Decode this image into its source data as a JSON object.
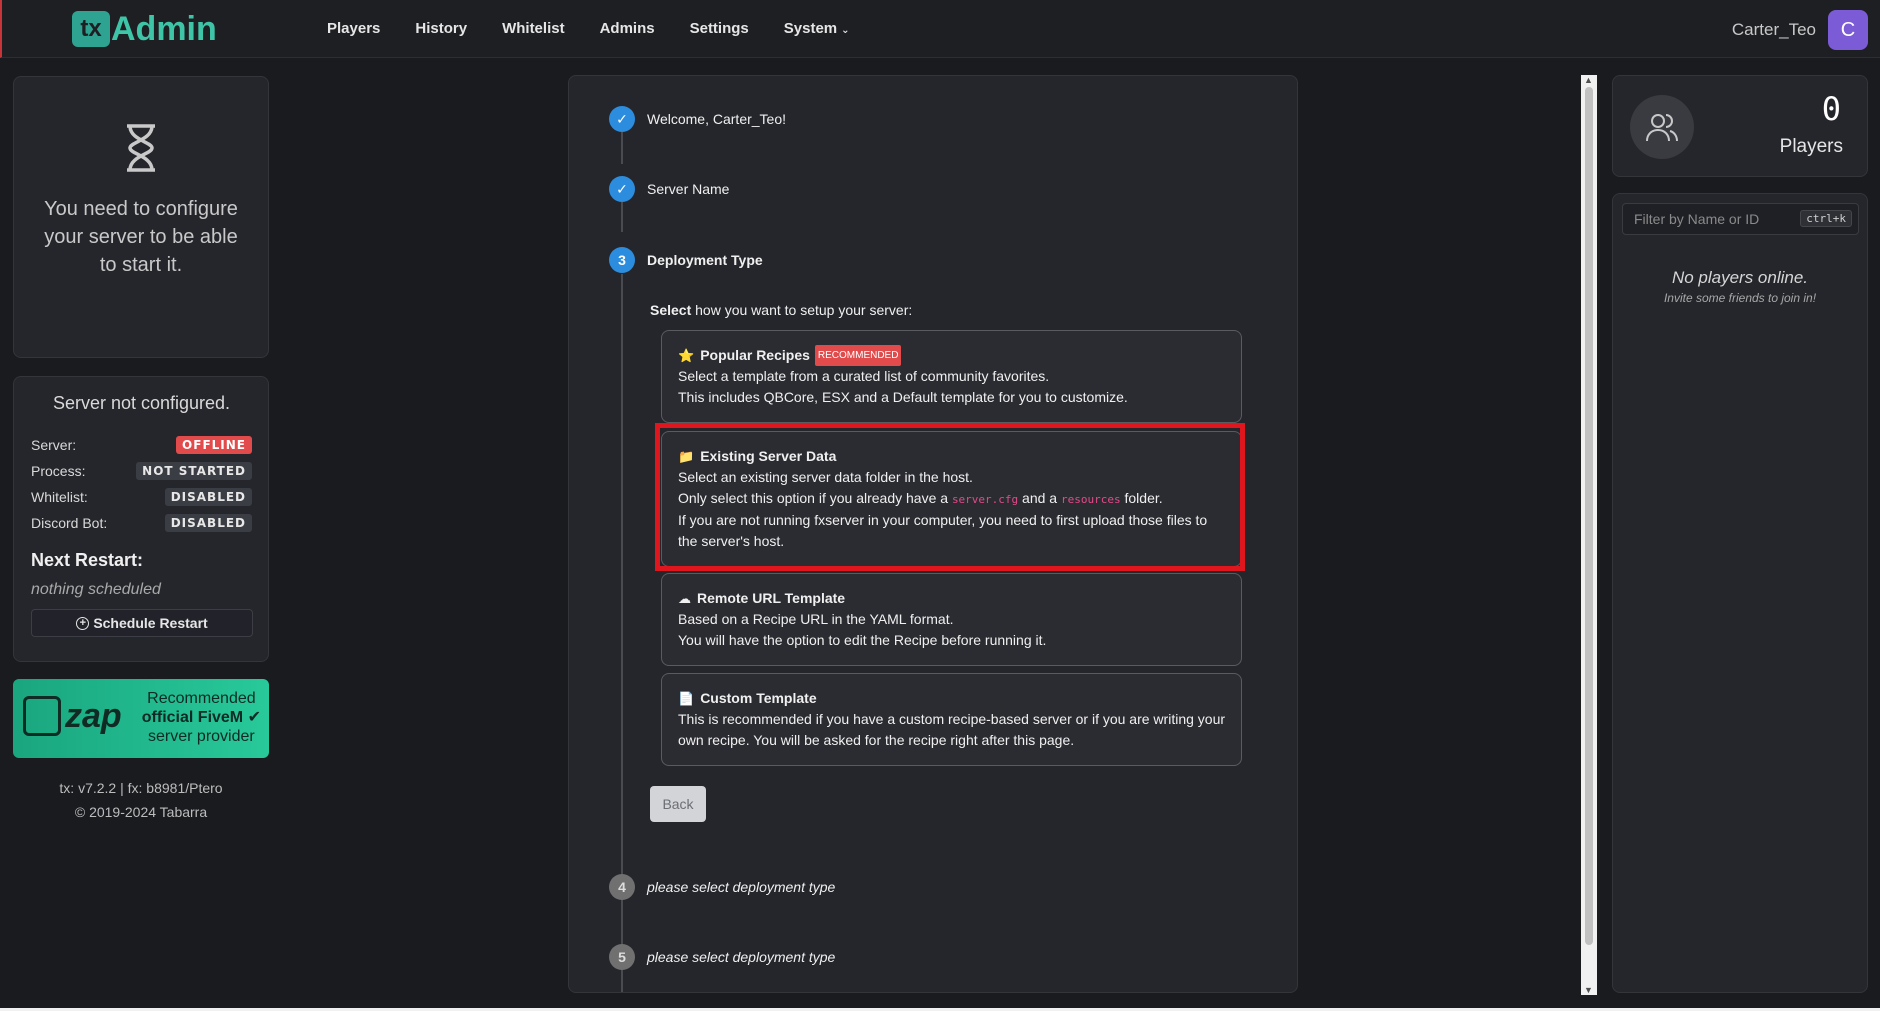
{
  "header": {
    "logo_mark": "tx",
    "logo_text": "Admin",
    "nav": [
      "Players",
      "History",
      "Whitelist",
      "Admins",
      "Settings",
      "System"
    ],
    "user_name": "Carter_Teo",
    "avatar_letter": "C"
  },
  "sidebar": {
    "config_message": "You need to configure your server to be able to start it.",
    "status_title": "Server not configured.",
    "status_rows": [
      {
        "label": "Server:",
        "value": "OFFLINE"
      },
      {
        "label": "Process:",
        "value": "NOT STARTED"
      },
      {
        "label": "Whitelist:",
        "value": "DISABLED"
      },
      {
        "label": "Discord Bot:",
        "value": "DISABLED"
      }
    ],
    "next_restart_title": "Next Restart:",
    "next_restart_value": "nothing scheduled",
    "schedule_button": "Schedule Restart",
    "zap": {
      "word": "zap",
      "line1": "Recommended",
      "line2": "official FiveM",
      "line3": "server provider"
    },
    "version": "tx: v7.2.2 | fx: b8981/Ptero",
    "copyright": "© 2019-2024 Tabarra"
  },
  "wizard": {
    "steps": [
      {
        "number": "1",
        "label": "Welcome, Carter_Teo!",
        "state": "done"
      },
      {
        "number": "2",
        "label": "Server Name",
        "state": "done"
      },
      {
        "number": "3",
        "label": "Deployment Type",
        "state": "active"
      },
      {
        "number": "4",
        "label": "please select deployment type",
        "state": "pending"
      },
      {
        "number": "5",
        "label": "please select deployment type",
        "state": "pending"
      }
    ],
    "select_bold": "Select",
    "select_rest": " how you want to setup your server:",
    "options": [
      {
        "icon": "star-icon",
        "title": "Popular Recipes",
        "badge": "RECOMMENDED",
        "lines": [
          "Select a template from a curated list of community favorites.",
          "This includes QBCore, ESX and a Default template for you to customize."
        ]
      },
      {
        "icon": "folder-icon",
        "title": "Existing Server Data",
        "line1": "Select an existing server data folder in the host.",
        "line2_a": "Only select this option if you already have a ",
        "code1": "server.cfg",
        "line2_b": " and a ",
        "code2": "resources",
        "line2_c": " folder.",
        "line3": "If you are not running fxserver in your computer, you need to first upload those files to the server's host."
      },
      {
        "icon": "cloud-download-icon",
        "title": "Remote URL Template",
        "lines": [
          "Based on a Recipe URL in the YAML format.",
          "You will have the option to edit the Recipe before running it."
        ]
      },
      {
        "icon": "document-icon",
        "title": "Custom Template",
        "lines": [
          "This is recommended if you have a custom recipe-based server or if you are writing your own recipe. You will be asked for the recipe right after this page."
        ]
      }
    ],
    "back_button": "Back"
  },
  "players_panel": {
    "count": "0",
    "label": "Players",
    "filter_placeholder": "Filter by Name or ID",
    "shortcut": "ctrl+k",
    "empty_title": "No players online.",
    "empty_subtitle": "Invite some friends to join in!"
  }
}
